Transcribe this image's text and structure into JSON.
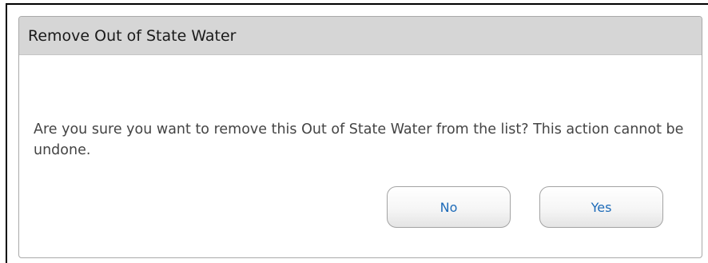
{
  "dialog": {
    "title": "Remove Out of State Water",
    "message": "Are you sure you want to remove this Out of State Water from the list?  This action cannot be undone.",
    "buttons": {
      "no_label": "No",
      "yes_label": "Yes"
    }
  },
  "colors": {
    "header_background": "#d6d6d6",
    "button_text": "#1e6bb8",
    "message_text": "#444444",
    "border": "#a9a9a9"
  }
}
